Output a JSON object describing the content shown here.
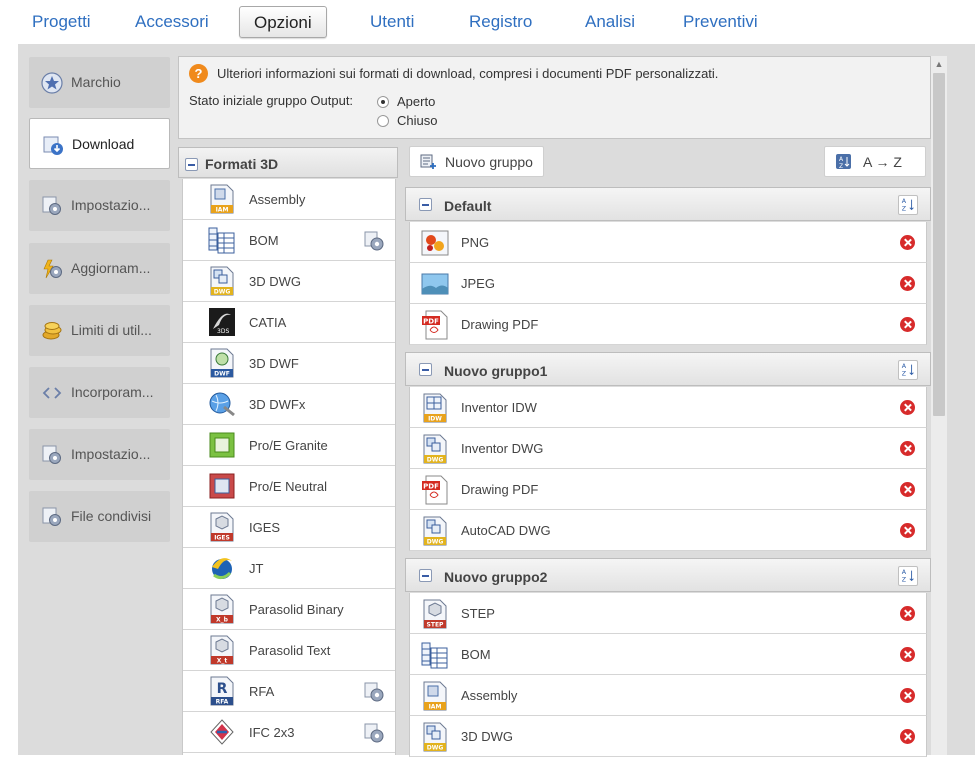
{
  "nav": {
    "tabs": [
      {
        "label": "Progetti"
      },
      {
        "label": "Accessori"
      },
      {
        "label": "Opzioni"
      },
      {
        "label": "Utenti"
      },
      {
        "label": "Registro"
      },
      {
        "label": "Analisi"
      },
      {
        "label": "Preventivi"
      }
    ],
    "active_tab": "Opzioni"
  },
  "sidebar": {
    "items": [
      {
        "label": "Marchio",
        "icon": "star-badge-icon"
      },
      {
        "label": "Download",
        "icon": "download-icon"
      },
      {
        "label": "Impostazio...",
        "icon": "settings-icon"
      },
      {
        "label": "Aggiornam...",
        "icon": "update-gear-icon"
      },
      {
        "label": "Limiti di util...",
        "icon": "coins-icon"
      },
      {
        "label": "Incorporam...",
        "icon": "embed-code-icon"
      },
      {
        "label": "Impostazio...",
        "icon": "settings-icon"
      },
      {
        "label": "File condivisi",
        "icon": "shared-files-icon"
      }
    ],
    "active": "Download"
  },
  "info": {
    "help_icon": "?",
    "text": "Ulteriori informazioni sui formati di download, compresi i documenti PDF personalizzati.",
    "state_label": "Stato iniziale gruppo Output:",
    "options": [
      {
        "label": "Aperto",
        "checked": true
      },
      {
        "label": "Chiuso",
        "checked": false
      }
    ]
  },
  "formats": {
    "title": "Formati 3D",
    "items": [
      {
        "name": "Assembly",
        "icon": "iam-file-icon",
        "badge": "IAM",
        "gear": false
      },
      {
        "name": "BOM",
        "icon": "bom-table-icon",
        "badge": "",
        "gear": true
      },
      {
        "name": "3D DWG",
        "icon": "dwg-file-icon",
        "badge": "DWG",
        "gear": false
      },
      {
        "name": "CATIA",
        "icon": "catia-icon",
        "badge": "",
        "gear": false
      },
      {
        "name": "3D DWF",
        "icon": "dwf-file-icon",
        "badge": "DWF",
        "gear": false
      },
      {
        "name": "3D DWFx",
        "icon": "dwfx-globe-icon",
        "badge": "",
        "gear": false
      },
      {
        "name": "Pro/E Granite",
        "icon": "proe-granite-icon",
        "badge": "",
        "gear": false
      },
      {
        "name": "Pro/E Neutral",
        "icon": "proe-neutral-icon",
        "badge": "",
        "gear": false
      },
      {
        "name": "IGES",
        "icon": "iges-file-icon",
        "badge": "IGES",
        "gear": false
      },
      {
        "name": "JT",
        "icon": "jt-icon",
        "badge": "",
        "gear": false
      },
      {
        "name": "Parasolid Binary",
        "icon": "parasolid-binary-icon",
        "badge": "X_b",
        "gear": false
      },
      {
        "name": "Parasolid Text",
        "icon": "parasolid-text-icon",
        "badge": "X_t",
        "gear": false
      },
      {
        "name": "RFA",
        "icon": "rfa-file-icon",
        "badge": "RFA",
        "gear": true
      },
      {
        "name": "IFC 2x3",
        "icon": "ifc-icon",
        "badge": "",
        "gear": true
      }
    ]
  },
  "toolbar": {
    "new_group_label": "Nuovo gruppo",
    "sort_label": "A → Z"
  },
  "groups": [
    {
      "title": "Default",
      "items": [
        {
          "name": "PNG",
          "icon": "png-image-icon"
        },
        {
          "name": "JPEG",
          "icon": "jpeg-image-icon"
        },
        {
          "name": "Drawing PDF",
          "icon": "pdf-file-icon"
        }
      ]
    },
    {
      "title": "Nuovo gruppo1",
      "items": [
        {
          "name": "Inventor IDW",
          "icon": "idw-file-icon"
        },
        {
          "name": "Inventor DWG",
          "icon": "dwg-file-icon"
        },
        {
          "name": "Drawing PDF",
          "icon": "pdf-file-icon"
        },
        {
          "name": "AutoCAD DWG",
          "icon": "dwg-file-icon"
        }
      ]
    },
    {
      "title": "Nuovo gruppo2",
      "items": [
        {
          "name": "STEP",
          "icon": "step-file-icon"
        },
        {
          "name": "BOM",
          "icon": "bom-table-icon"
        },
        {
          "name": "Assembly",
          "icon": "iam-file-icon"
        },
        {
          "name": "3D DWG",
          "icon": "dwg-file-icon"
        }
      ]
    }
  ],
  "colors": {
    "nav_link": "#2f6fc0",
    "frame_bg": "#dcdcdc",
    "delete_red": "#d72b2b",
    "help_orange": "#f08a1c"
  }
}
